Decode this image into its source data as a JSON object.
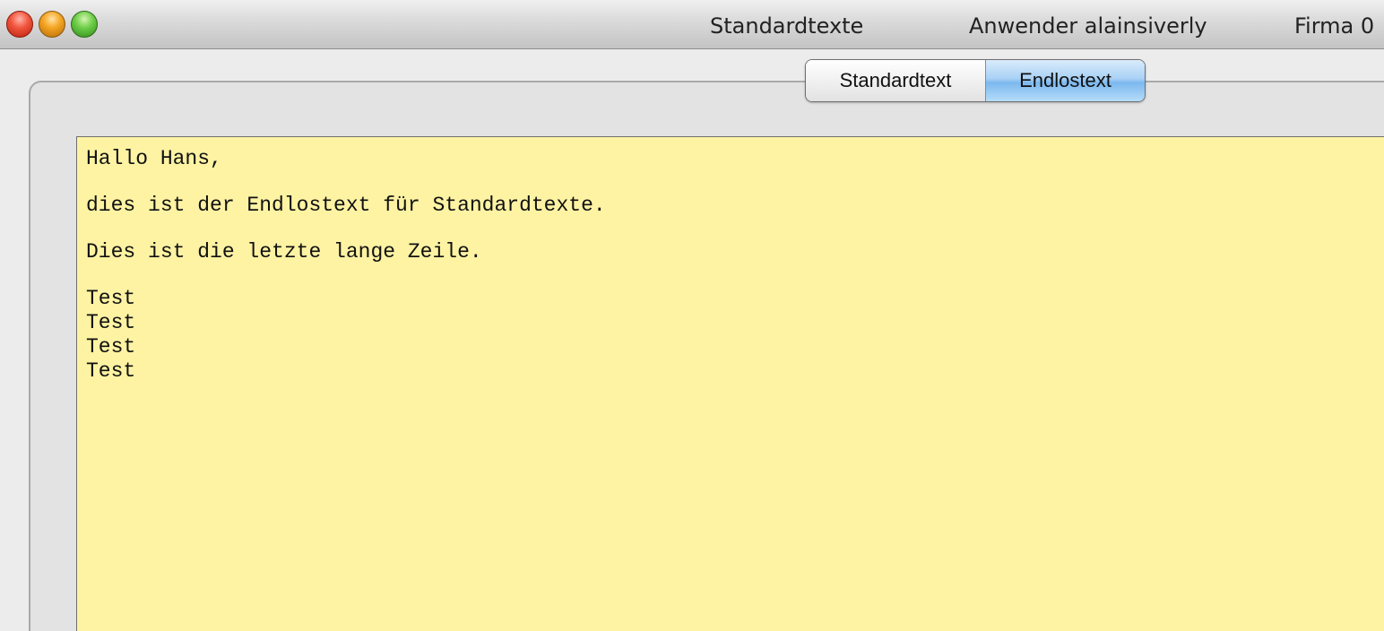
{
  "window": {
    "title": "Standardtexte",
    "user_label": "Anwender alainsiverly",
    "company_label": "Firma 0"
  },
  "traffic_lights": [
    "close-icon",
    "minimize-icon",
    "zoom-icon"
  ],
  "tabs": [
    {
      "label": "Standardtext",
      "selected": false
    },
    {
      "label": "Endlostext",
      "selected": true
    }
  ],
  "editor": {
    "background_color": "#fdf3a3",
    "lines": [
      "Hallo Hans,",
      "dies ist der Endlostext für Standardtexte.",
      "Dies ist die letzte lange Zeile.",
      "Test",
      "Test",
      "Test",
      "Test"
    ]
  },
  "colors": {
    "selected_tab": "#7cb8ee",
    "editor_background": "#fdf3a3"
  }
}
